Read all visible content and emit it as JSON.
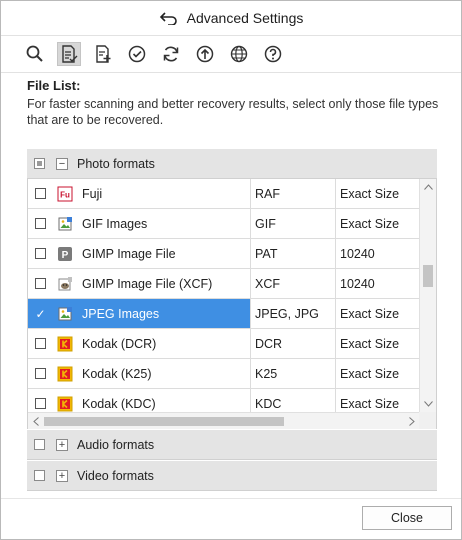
{
  "window": {
    "title": "Advanced Settings"
  },
  "toolbar": {
    "tools": [
      {
        "icon": "search-icon"
      },
      {
        "icon": "file-list-icon",
        "active": true
      },
      {
        "icon": "add-file-icon"
      },
      {
        "icon": "check-icon"
      },
      {
        "icon": "refresh-icon"
      },
      {
        "icon": "upload-icon"
      },
      {
        "icon": "globe-icon"
      },
      {
        "icon": "help-icon"
      }
    ]
  },
  "info": {
    "heading": "File List:",
    "description": "For faster scanning and better recovery results, select only those file types that are to be recovered."
  },
  "groups": {
    "photo": {
      "label": "Photo formats",
      "expand_symbol": "−"
    },
    "audio": {
      "label": "Audio formats",
      "expand_symbol": "+"
    },
    "video": {
      "label": "Video formats",
      "expand_symbol": "+"
    }
  },
  "photo_rows": [
    {
      "name": "Fuji",
      "extension": "RAF",
      "size": "Exact Size",
      "checked": false,
      "icon": "fuji-icon"
    },
    {
      "name": "GIF Images",
      "extension": "GIF",
      "size": "Exact Size",
      "checked": false,
      "icon": "image-file-icon"
    },
    {
      "name": "GIMP Image File",
      "extension": "PAT",
      "size": "10240",
      "checked": false,
      "icon": "gimp-pattern-icon"
    },
    {
      "name": "GIMP Image File (XCF)",
      "extension": "XCF",
      "size": "10240",
      "checked": false,
      "icon": "gimp-icon"
    },
    {
      "name": "JPEG Images",
      "extension": "JPEG, JPG",
      "size": "Exact Size",
      "checked": true,
      "selected": true,
      "icon": "image-file-icon"
    },
    {
      "name": "Kodak (DCR)",
      "extension": "DCR",
      "size": "Exact Size",
      "checked": false,
      "icon": "kodak-icon"
    },
    {
      "name": "Kodak (K25)",
      "extension": "K25",
      "size": "Exact Size",
      "checked": false,
      "icon": "kodak-icon"
    },
    {
      "name": "Kodak (KDC)",
      "extension": "KDC",
      "size": "Exact Size",
      "checked": false,
      "icon": "kodak-icon"
    }
  ],
  "check_mark": "✓",
  "footer": {
    "close_label": "Close"
  },
  "colors": {
    "selection": "#3f8fe3",
    "group_header": "#e4e4e4",
    "kodak": "#f2b705"
  }
}
